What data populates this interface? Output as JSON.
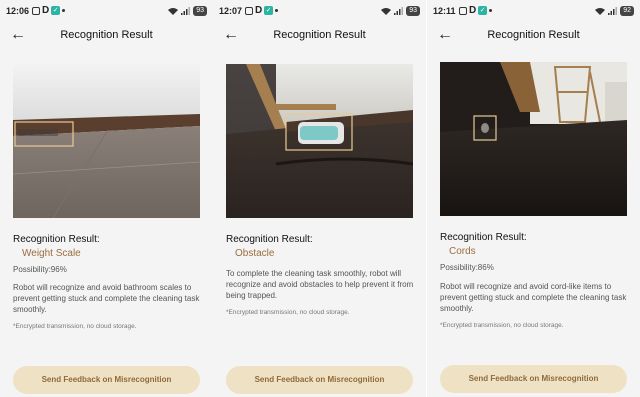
{
  "screens": [
    {
      "time": "12:06",
      "battery": "93",
      "title": "Recognition Result",
      "result_label": "Recognition Result:",
      "result_value": "Weight Scale",
      "possibility": "Possibility:96%",
      "description": "Robot will recognize and avoid bathroom scales to prevent getting stuck and complete the cleaning task smoothly.",
      "note": "*Encrypted transmission, no cloud storage.",
      "button": "Send Feedback on Misrecognition"
    },
    {
      "time": "12:07",
      "battery": "93",
      "title": "Recognition Result",
      "result_label": "Recognition Result:",
      "result_value": "Obstacle",
      "possibility": "",
      "description": "To complete the cleaning task smoothly, robot will recognize and avoid obstacles to help prevent it from being trapped.",
      "note": "*Encrypted transmission, no cloud storage.",
      "button": "Send Feedback on Misrecognition"
    },
    {
      "time": "12:11",
      "battery": "92",
      "title": "Recognition Result",
      "result_label": "Recognition Result:",
      "result_value": "Cords",
      "possibility": "Possibility:86%",
      "description": "Robot will recognize and avoid cord-like items to prevent getting stuck and complete the cleaning task smoothly.",
      "note": "*Encrypted transmission, no cloud storage.",
      "button": "Send Feedback on Misrecognition"
    }
  ],
  "icons": {
    "back": "arrow-left",
    "status": [
      "screen-record-icon",
      "d-app-icon",
      "check-app-icon",
      "dot-icon",
      "wifi-icon",
      "signal-icon",
      "battery-icon"
    ]
  },
  "colors": {
    "accent_text": "#9a6e3f",
    "button_bg": "#efe2c4",
    "background": "#f4f4f4"
  }
}
